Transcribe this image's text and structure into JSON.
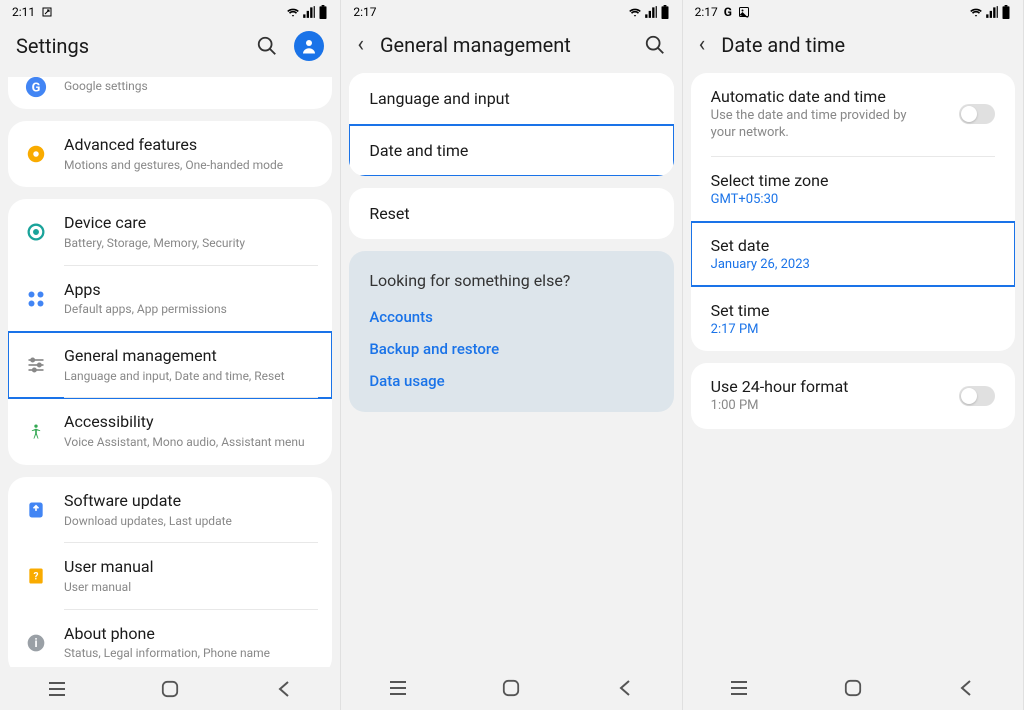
{
  "phone1": {
    "status_time": "2:11",
    "header_title": "Settings",
    "items": [
      {
        "title": "",
        "sub": "Google settings"
      },
      {
        "title": "Advanced features",
        "sub": "Motions and gestures, One-handed mode"
      },
      {
        "title": "Device care",
        "sub": "Battery, Storage, Memory, Security"
      },
      {
        "title": "Apps",
        "sub": "Default apps, App permissions"
      },
      {
        "title": "General management",
        "sub": "Language and input, Date and time, Reset"
      },
      {
        "title": "Accessibility",
        "sub": "Voice Assistant, Mono audio, Assistant menu"
      },
      {
        "title": "Software update",
        "sub": "Download updates, Last update"
      },
      {
        "title": "User manual",
        "sub": "User manual"
      },
      {
        "title": "About phone",
        "sub": "Status, Legal information, Phone name"
      }
    ]
  },
  "phone2": {
    "status_time": "2:17",
    "header_title": "General management",
    "rows": [
      {
        "label": "Language and input"
      },
      {
        "label": "Date and time"
      },
      {
        "label": "Reset"
      }
    ],
    "looking_heading": "Looking for something else?",
    "looking_links": [
      "Accounts",
      "Backup and restore",
      "Data usage"
    ]
  },
  "phone3": {
    "status_time": "2:17",
    "status_extra": "G",
    "header_title": "Date and time",
    "auto_title": "Automatic date and time",
    "auto_sub": "Use the date and time provided by your network.",
    "tz_title": "Select time zone",
    "tz_value": "GMT+05:30",
    "setdate_title": "Set date",
    "setdate_value": "January 26, 2023",
    "settime_title": "Set time",
    "settime_value": "2:17 PM",
    "h24_title": "Use 24-hour format",
    "h24_sub": "1:00 PM"
  }
}
